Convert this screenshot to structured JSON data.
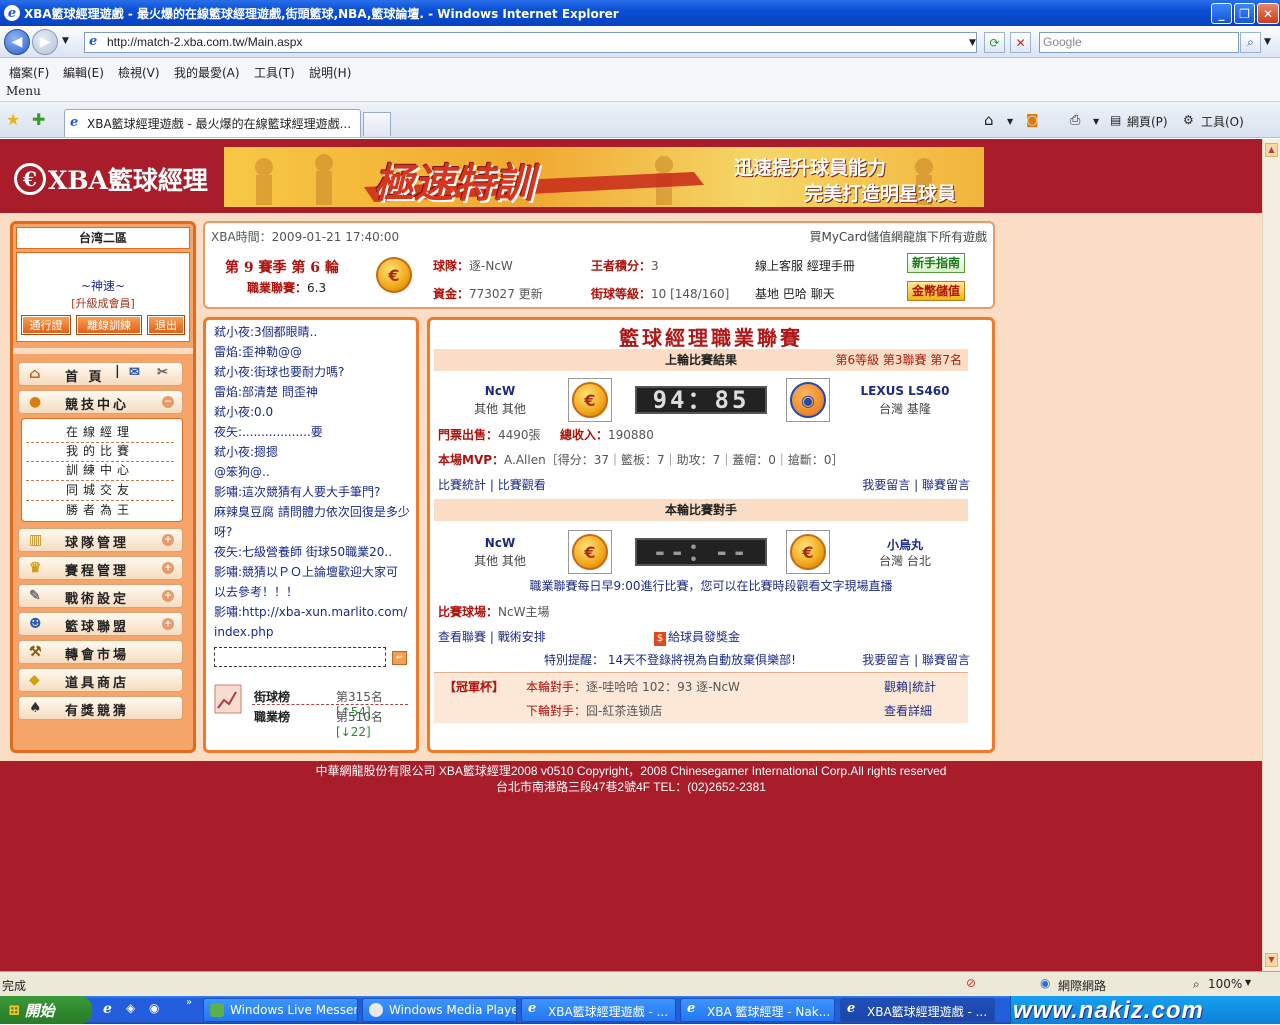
{
  "window": {
    "title": "XBA籃球經理遊戲 - 最火爆的在線籃球經理遊戲,街頭籃球,NBA,籃球論壇. - Windows Internet Explorer",
    "url": "http://match-2.xba.com.tw/Main.aspx",
    "search_placeholder": "Google",
    "menu": [
      "檔案(F)",
      "編輯(E)",
      "檢視(V)",
      "我的最愛(A)",
      "工具(T)",
      "說明(H)"
    ],
    "menu_label": "Menu",
    "tab_title": "XBA籃球經理遊戲 - 最火爆的在線籃球經理遊戲...",
    "toolbar": {
      "page": "網頁(P)",
      "tools": "工具(O)"
    }
  },
  "site": {
    "logo": "XBA籃球經理",
    "banner_big": "極速特訓",
    "banner_line1": "迅速提升球員能力",
    "banner_line2": "完美打造明星球員"
  },
  "user": {
    "server": "台湾二區",
    "name": "~神速~",
    "rank": "[升級成會員]",
    "btn_pass": "通行證",
    "btn_offline": "離線訓練",
    "btn_logout": "退出"
  },
  "sidebar": {
    "home": "首 頁",
    "competition": "競技中心",
    "sub": [
      "在線經理",
      "我的比賽",
      "訓練中心",
      "同城交友",
      "勝者為王"
    ],
    "items": [
      "球隊管理",
      "賽程管理",
      "戰術設定",
      "籃球聯盟",
      "轉會市場",
      "道具商店",
      "有獎競猜"
    ]
  },
  "info": {
    "time_label": "XBA時間：2009-01-21 17:40:00",
    "mycard": "買MyCard儲值網龍旗下所有遊戲",
    "season": "第 9 賽季 第 6 輪",
    "career_label": "職業聯賽：",
    "career_val": "6.3",
    "team_label": "球隊：",
    "team_val": "逐-NcW",
    "king_label": "王者積分：",
    "king_val": "3",
    "service": "線上客服",
    "manual": "經理手冊",
    "guide_btn": "新手指南",
    "money_label": "資金：",
    "money_val": "773027",
    "update": "更新",
    "street_label": "街球等級：",
    "street_val": "10 [148/160]",
    "base": "基地",
    "bar": "巴哈",
    "chat": "聊天",
    "gold_btn": "金幣儲值"
  },
  "chat": {
    "messages": [
      "弒小夜:3個都眼睛..",
      "雷焰:歪神勒@@",
      "弒小夜:街球也要耐力嗎?",
      "雷焰:部清楚  問歪神",
      "弒小夜:0.0",
      "夜矢:..................要",
      "弒小夜:摁摁",
      "@笨狗@..",
      "影嘯:這次競猜有人要大手筆門?",
      "麻辣臭豆腐 請問體力依次回復是多少呀?",
      "夜矢:七級營養師  街球50職業20..",
      "影嘯:競猜以ＰＯ上論壇歡迎大家可以去參考！！！",
      "影嘯:http://xba-xun.marlito.com/index.php"
    ],
    "rank_street": "街球榜",
    "rank_street_val": "第315名",
    "rank_street_delta": "[↑54]",
    "rank_career": "職業榜",
    "rank_career_val": "第510名",
    "rank_career_delta": "[↓22]"
  },
  "league": {
    "title": "籃球經理職業聯賽",
    "last_result": "上輪比賽結果",
    "level": "第6等級  第3聯賽  第7名",
    "home_team": "NcW",
    "home_loc": "其他  其他",
    "score": "94：85",
    "away_team": "LEXUS LS460",
    "away_loc": "台灣  基隆",
    "tickets_label": "門票出售：",
    "tickets_val": "4490張",
    "income_label": "總收入：",
    "income_val": "190880",
    "mvp_label": "本場MVP：",
    "mvp_val": "A.Allen［得分：37｜籃板：7｜助攻：7｜蓋帽：0｜搶斷：0］",
    "stats_link": "比賽統計",
    "watch_link": "比賽觀看",
    "msg_link": "我要留言",
    "league_msg": "聯賽留言",
    "this_round": "本輪比賽對手",
    "next_home": "NcW",
    "next_home_loc": "其他  其他",
    "next_score": "--：--",
    "next_away": "小烏丸",
    "next_away_loc": "台灣  台北",
    "notice": "職業聯賽每日早9:00進行比賽，您可以在比賽時段觀看文字現場直播",
    "venue_label": "比賽球場：",
    "venue_val": "NcW主場",
    "view_league": "查看聯賽",
    "tactics": "戰術安排",
    "bonus": "給球員發獎金",
    "remind": "特別提醒：  14天不登錄將視為自動放棄俱樂部!",
    "cup": "【冠軍杯】",
    "cup_this_label": "本輪對手：",
    "cup_this_val": "逐-哇哈哈  102：93 逐-NcW",
    "cup_watch": "觀賴",
    "cup_stats": "統計",
    "cup_next_label": "下輪對手：",
    "cup_next_val": "囧-紅茶连锁店",
    "cup_detail": "查看詳細"
  },
  "footer": {
    "line1": "中華網龍股份有限公司  XBA籃球經理2008 v0510    Copyright，2008 Chinesegamer International Corp.All rights reserved",
    "line2": "台北市南港路三段47巷2號4F TEL：(02)2652-2381"
  },
  "status": {
    "text": "完成",
    "zone": "網際網路",
    "zoom": "100%"
  },
  "taskbar": {
    "start": "開始",
    "tasks": [
      "Windows Live Messen...",
      "Windows Media Player",
      "XBA籃球經理遊戲 - ...",
      "XBA 籃球經理 - Nak...",
      "XBA籃球經理遊戲 - ..."
    ],
    "watermark": "www.nakiz.com"
  },
  "colors": {
    "brand_red": "#a91d2b",
    "panel_orange": "#f07a2a",
    "peach": "#fbdcc4"
  }
}
